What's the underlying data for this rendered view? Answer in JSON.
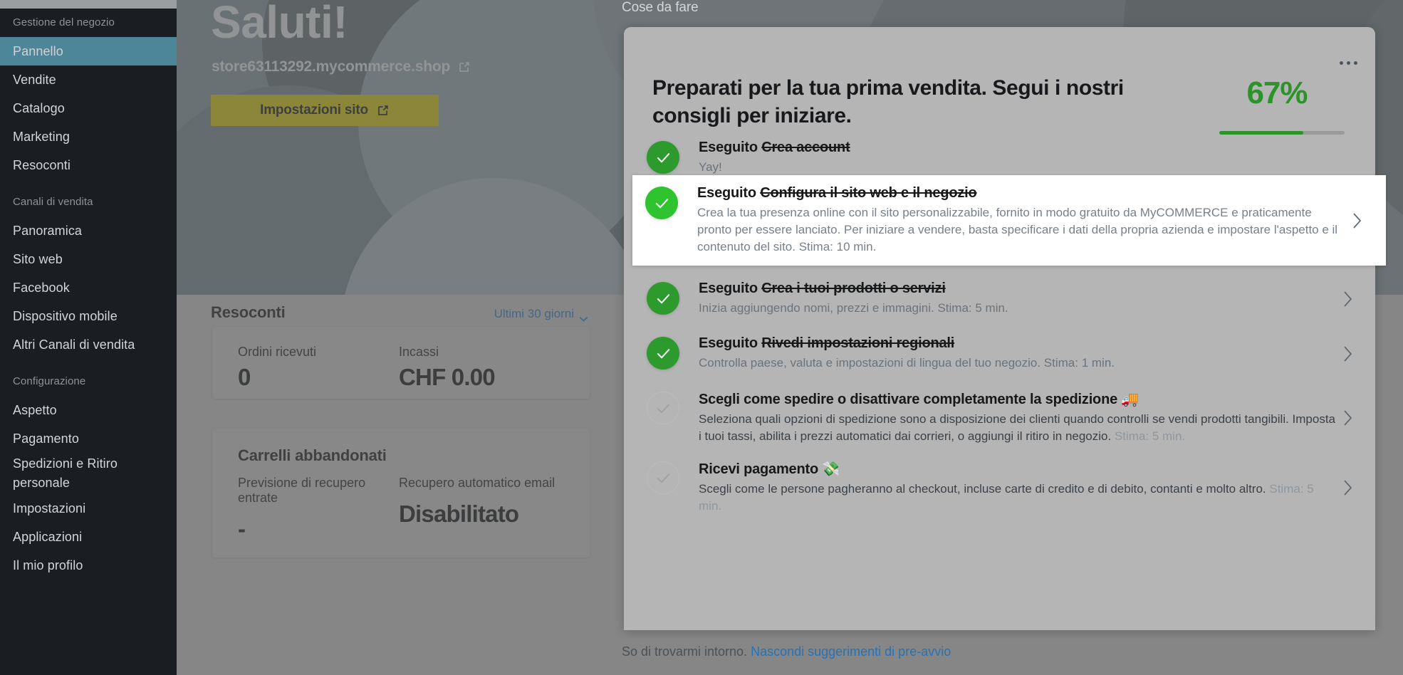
{
  "sidebar": {
    "sections": [
      {
        "label": "Gestione del negozio",
        "items": [
          {
            "label": "Pannello",
            "active": true
          },
          {
            "label": "Vendite",
            "active": false
          },
          {
            "label": "Catalogo",
            "active": false
          },
          {
            "label": "Marketing",
            "active": false
          },
          {
            "label": "Resoconti",
            "active": false
          }
        ]
      },
      {
        "label": "Canali di vendita",
        "items": [
          {
            "label": "Panoramica",
            "active": false
          },
          {
            "label": "Sito web",
            "active": false
          },
          {
            "label": "Facebook",
            "active": false
          },
          {
            "label": "Dispositivo mobile",
            "active": false
          },
          {
            "label": "Altri Canali di vendita",
            "active": false
          }
        ]
      },
      {
        "label": "Configurazione",
        "items": [
          {
            "label": "Aspetto",
            "active": false
          },
          {
            "label": "Pagamento",
            "active": false
          },
          {
            "label": "Spedizioni e Ritiro personale",
            "active": false
          },
          {
            "label": "Impostazioni",
            "active": false
          },
          {
            "label": "Applicazioni",
            "active": false
          },
          {
            "label": "Il mio profilo",
            "active": false
          }
        ]
      }
    ]
  },
  "hero": {
    "greeting": "Saluti!",
    "store_url": "store63113292.mycommerce.shop",
    "external_link_icon": "external-link-icon",
    "site_settings_button": "Impostazioni sito"
  },
  "reports": {
    "title": "Resoconti",
    "range_label": "Ultimi 30 giorni",
    "range_chevron_icon": "chevron-down-icon",
    "stats_card": {
      "orders_label": "Ordini ricevuti",
      "orders_value": "0",
      "revenue_label": "Incassi",
      "revenue_value": "CHF 0.00"
    },
    "carts_card": {
      "title": "Carrelli abbandonati",
      "forecast_label": "Previsione di recupero entrate",
      "forecast_value": "-",
      "autoemail_label": "Recupero automatico email",
      "autoemail_value": "Disabilitato"
    }
  },
  "todo": {
    "section_label": "Cose da fare",
    "heading": "Preparati per la tua prima vendita. Segui i nostri consigli per iniziare.",
    "progress_percent_label": "67%",
    "progress_percent_value": 67,
    "kebab_icon": "more-options-icon",
    "done_word": "Eseguito",
    "chevron_icon": "chevron-right-icon",
    "check_icon": "check-icon",
    "accent_green": "#2d9a2d",
    "accent_blue": "#2572b8",
    "items": [
      {
        "status": "done",
        "title": "Crea account",
        "desc": "Yay!",
        "est": "",
        "highlighted": false,
        "has_chevron": false
      },
      {
        "status": "done",
        "title": "Configura il sito web e il negozio",
        "desc": "Crea la tua presenza online con il sito personalizzabile, fornito in modo gratuito da MyCOMMERCE e praticamente pronto per essere lanciato. Per iniziare a vendere, basta specificare i dati della propria azienda e impostare l'aspetto e il contenuto del sito. Stima: 10 min.",
        "est": "",
        "highlighted": true,
        "has_chevron": true
      },
      {
        "status": "done",
        "title": "Crea i tuoi prodotti o servizi",
        "desc": "Inizia aggiungendo nomi, prezzi e immagini. Stima: 5 min.",
        "est": "",
        "highlighted": false,
        "has_chevron": true
      },
      {
        "status": "done",
        "title": "Rivedi impostazioni regionali",
        "desc": "Controlla paese, valuta e impostazioni di lingua del tuo negozio. Stima: 1 min.",
        "est": "",
        "highlighted": false,
        "has_chevron": true
      },
      {
        "status": "todo",
        "title": "Scegli come spedire o disattivare completamente la spedizione 🚚",
        "desc": "Seleziona quali opzioni di spedizione sono a disposizione dei clienti quando controlli se vendi prodotti tangibili. Imposta i tuoi tassi, abilita i prezzi automatici dai corrieri, o aggiungi il ritiro in negozio. ",
        "est": "Stima: 5 min.",
        "highlighted": false,
        "has_chevron": true
      },
      {
        "status": "todo",
        "title": "Ricevi pagamento 💸",
        "desc": "Scegli come le persone pagheranno al checkout, incluse carte di credito e di debito, contanti e molto altro. ",
        "est": "Stima: 5 min.",
        "highlighted": false,
        "has_chevron": true
      }
    ],
    "footer_text": "So di trovarmi intorno. ",
    "footer_link": "Nascondi suggerimenti di pre-avvio"
  }
}
